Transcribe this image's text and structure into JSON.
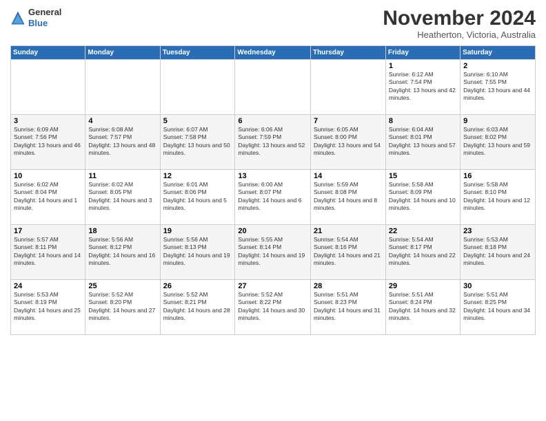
{
  "logo": {
    "general": "General",
    "blue": "Blue"
  },
  "title": "November 2024",
  "subtitle": "Heatherton, Victoria, Australia",
  "days_header": [
    "Sunday",
    "Monday",
    "Tuesday",
    "Wednesday",
    "Thursday",
    "Friday",
    "Saturday"
  ],
  "weeks": [
    [
      {
        "day": "",
        "info": ""
      },
      {
        "day": "",
        "info": ""
      },
      {
        "day": "",
        "info": ""
      },
      {
        "day": "",
        "info": ""
      },
      {
        "day": "",
        "info": ""
      },
      {
        "day": "1",
        "info": "Sunrise: 6:12 AM\nSunset: 7:54 PM\nDaylight: 13 hours and 42 minutes."
      },
      {
        "day": "2",
        "info": "Sunrise: 6:10 AM\nSunset: 7:55 PM\nDaylight: 13 hours and 44 minutes."
      }
    ],
    [
      {
        "day": "3",
        "info": "Sunrise: 6:09 AM\nSunset: 7:56 PM\nDaylight: 13 hours and 46 minutes."
      },
      {
        "day": "4",
        "info": "Sunrise: 6:08 AM\nSunset: 7:57 PM\nDaylight: 13 hours and 48 minutes."
      },
      {
        "day": "5",
        "info": "Sunrise: 6:07 AM\nSunset: 7:58 PM\nDaylight: 13 hours and 50 minutes."
      },
      {
        "day": "6",
        "info": "Sunrise: 6:06 AM\nSunset: 7:59 PM\nDaylight: 13 hours and 52 minutes."
      },
      {
        "day": "7",
        "info": "Sunrise: 6:05 AM\nSunset: 8:00 PM\nDaylight: 13 hours and 54 minutes."
      },
      {
        "day": "8",
        "info": "Sunrise: 6:04 AM\nSunset: 8:01 PM\nDaylight: 13 hours and 57 minutes."
      },
      {
        "day": "9",
        "info": "Sunrise: 6:03 AM\nSunset: 8:02 PM\nDaylight: 13 hours and 59 minutes."
      }
    ],
    [
      {
        "day": "10",
        "info": "Sunrise: 6:02 AM\nSunset: 8:04 PM\nDaylight: 14 hours and 1 minute."
      },
      {
        "day": "11",
        "info": "Sunrise: 6:02 AM\nSunset: 8:05 PM\nDaylight: 14 hours and 3 minutes."
      },
      {
        "day": "12",
        "info": "Sunrise: 6:01 AM\nSunset: 8:06 PM\nDaylight: 14 hours and 5 minutes."
      },
      {
        "day": "13",
        "info": "Sunrise: 6:00 AM\nSunset: 8:07 PM\nDaylight: 14 hours and 6 minutes."
      },
      {
        "day": "14",
        "info": "Sunrise: 5:59 AM\nSunset: 8:08 PM\nDaylight: 14 hours and 8 minutes."
      },
      {
        "day": "15",
        "info": "Sunrise: 5:58 AM\nSunset: 8:09 PM\nDaylight: 14 hours and 10 minutes."
      },
      {
        "day": "16",
        "info": "Sunrise: 5:58 AM\nSunset: 8:10 PM\nDaylight: 14 hours and 12 minutes."
      }
    ],
    [
      {
        "day": "17",
        "info": "Sunrise: 5:57 AM\nSunset: 8:11 PM\nDaylight: 14 hours and 14 minutes."
      },
      {
        "day": "18",
        "info": "Sunrise: 5:56 AM\nSunset: 8:12 PM\nDaylight: 14 hours and 16 minutes."
      },
      {
        "day": "19",
        "info": "Sunrise: 5:56 AM\nSunset: 8:13 PM\nDaylight: 14 hours and 19 minutes."
      },
      {
        "day": "20",
        "info": "Sunrise: 5:55 AM\nSunset: 8:14 PM\nDaylight: 14 hours and 19 minutes."
      },
      {
        "day": "21",
        "info": "Sunrise: 5:54 AM\nSunset: 8:16 PM\nDaylight: 14 hours and 21 minutes."
      },
      {
        "day": "22",
        "info": "Sunrise: 5:54 AM\nSunset: 8:17 PM\nDaylight: 14 hours and 22 minutes."
      },
      {
        "day": "23",
        "info": "Sunrise: 5:53 AM\nSunset: 8:18 PM\nDaylight: 14 hours and 24 minutes."
      }
    ],
    [
      {
        "day": "24",
        "info": "Sunrise: 5:53 AM\nSunset: 8:19 PM\nDaylight: 14 hours and 25 minutes."
      },
      {
        "day": "25",
        "info": "Sunrise: 5:52 AM\nSunset: 8:20 PM\nDaylight: 14 hours and 27 minutes."
      },
      {
        "day": "26",
        "info": "Sunrise: 5:52 AM\nSunset: 8:21 PM\nDaylight: 14 hours and 28 minutes."
      },
      {
        "day": "27",
        "info": "Sunrise: 5:52 AM\nSunset: 8:22 PM\nDaylight: 14 hours and 30 minutes."
      },
      {
        "day": "28",
        "info": "Sunrise: 5:51 AM\nSunset: 8:23 PM\nDaylight: 14 hours and 31 minutes."
      },
      {
        "day": "29",
        "info": "Sunrise: 5:51 AM\nSunset: 8:24 PM\nDaylight: 14 hours and 32 minutes."
      },
      {
        "day": "30",
        "info": "Sunrise: 5:51 AM\nSunset: 8:25 PM\nDaylight: 14 hours and 34 minutes."
      }
    ]
  ]
}
